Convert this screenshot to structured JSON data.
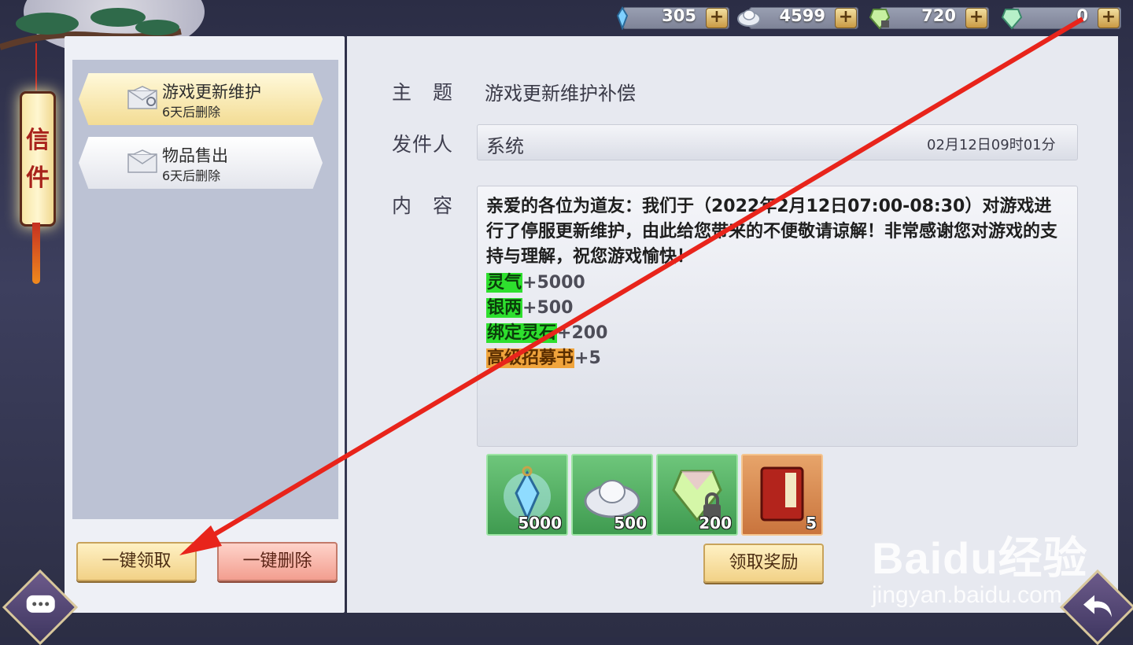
{
  "currencies": [
    {
      "icon": "spirit-crystal-icon",
      "value": "305"
    },
    {
      "icon": "silver-ingot-icon",
      "value": "4599"
    },
    {
      "icon": "bound-gem-icon",
      "value": "720"
    },
    {
      "icon": "gem-icon",
      "value": "0"
    }
  ],
  "plus_label": "+",
  "title_lantern": [
    "信",
    "件"
  ],
  "mail_list": [
    {
      "title": "游戏更新维护",
      "expiry": "6天后删除",
      "selected": true
    },
    {
      "title": "物品售出",
      "expiry": "6天后删除",
      "selected": false
    }
  ],
  "left_buttons": {
    "claim_all": "一键领取",
    "delete_all": "一键删除"
  },
  "detail": {
    "subject_label": "主　题",
    "subject": "游戏更新维护补偿",
    "sender_label": "发件人",
    "sender": "系统",
    "date": "02月12日09时01分",
    "content_label": "内　容",
    "content": "亲爱的各位为道友：我们于（2022年2月12日07:00-08:30）对游戏进行了停服更新维护，由此给您带来的不便敬请谅解！非常感谢您对游戏的支持与理解，祝您游戏愉快！",
    "reward_lines": [
      {
        "name": "灵气",
        "amount": "+5000",
        "color": "green"
      },
      {
        "name": "银两",
        "amount": "+500",
        "color": "green"
      },
      {
        "name": "绑定灵石",
        "amount": "+200",
        "color": "green"
      },
      {
        "name": "高级招募书",
        "amount": "+5",
        "color": "orange"
      }
    ],
    "reward_items": [
      {
        "icon": "spirit-crystal-icon",
        "count": "5000",
        "rarity": "green"
      },
      {
        "icon": "silver-ingot-icon",
        "count": "500",
        "rarity": "green"
      },
      {
        "icon": "bound-gem-icon",
        "count": "200",
        "rarity": "green"
      },
      {
        "icon": "recruit-book-icon",
        "count": "5",
        "rarity": "orange"
      }
    ],
    "claim_button": "领取奖励"
  },
  "watermark": {
    "logo": "Baidu经验",
    "url": "jingyan.baidu.com"
  },
  "colors": {
    "reward_green": "#2ee02e",
    "reward_orange": "#f0a43c",
    "arrow": "#e8241b"
  }
}
